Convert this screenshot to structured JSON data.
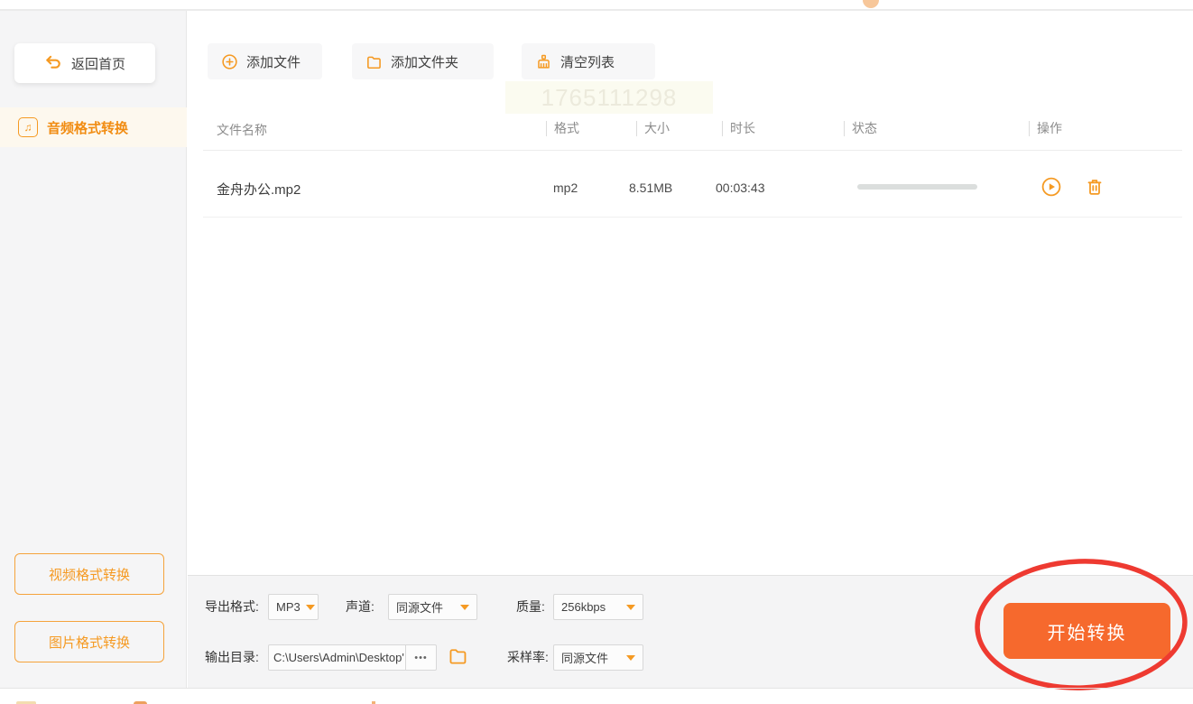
{
  "app": {
    "accent_color": "#f59a23",
    "start_button_color": "#f6692d",
    "annotation_color": "#ee3a31"
  },
  "sidebar": {
    "back_label": "返回首页",
    "active_item": {
      "label": "音频格式转换",
      "icon_glyph": "♫"
    },
    "bottom_buttons": [
      {
        "label": "视频格式转换"
      },
      {
        "label": "图片格式转换"
      }
    ]
  },
  "toolbar": {
    "buttons": [
      {
        "label": "添加文件"
      },
      {
        "label": "添加文件夹"
      },
      {
        "label": "清空列表"
      }
    ]
  },
  "watermark": "1765111298",
  "table": {
    "columns": [
      "文件名称",
      "格式",
      "大小",
      "时长",
      "状态",
      "操作"
    ],
    "rows": [
      {
        "name": "金舟办公.mp2",
        "format": "mp2",
        "size": "8.51MB",
        "duration": "00:03:43",
        "progress_percent": 0
      }
    ]
  },
  "settings": {
    "export_format": {
      "label": "导出格式:",
      "value": "MP3"
    },
    "channel": {
      "label": "声道:",
      "value": "同源文件"
    },
    "quality": {
      "label": "质量:",
      "value": "256kbps"
    },
    "output_dir": {
      "label": "输出目录:",
      "value": "C:\\Users\\Admin\\Desktop'",
      "more": "•••"
    },
    "sample_rate": {
      "label": "采样率:",
      "value": "同源文件"
    }
  },
  "start_button": {
    "label": "开始转换"
  }
}
